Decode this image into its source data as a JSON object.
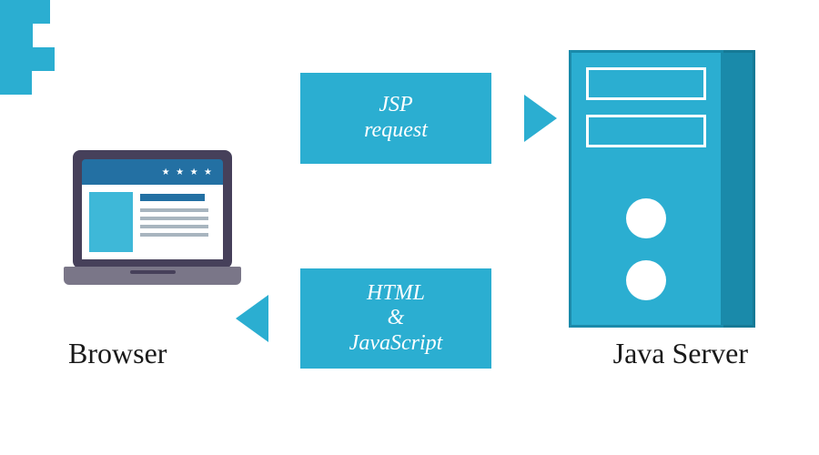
{
  "colors": {
    "accent": "#2baed1",
    "accent_dark": "#1a8aaa",
    "laptop_frame": "#46405a",
    "laptop_base": "#7a7688",
    "header_blue": "#2370a3",
    "thumb_blue": "#3eb8d8"
  },
  "browser": {
    "label": "Browser",
    "stars": "★ ★ ★ ★"
  },
  "server": {
    "label": "Java Server"
  },
  "request": {
    "line1": "JSP",
    "line2": "request"
  },
  "response": {
    "line1": "HTML",
    "line2": "&",
    "line3": "JavaScript"
  }
}
